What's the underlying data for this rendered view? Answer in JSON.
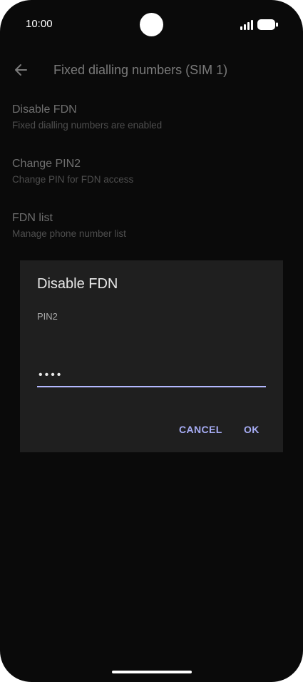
{
  "status_bar": {
    "time": "10:00",
    "icons": [
      "signal-icon",
      "battery-icon"
    ]
  },
  "app_bar": {
    "back_icon": "arrow-back-icon",
    "title": "Fixed dialling numbers (SIM 1)"
  },
  "settings": [
    {
      "title": "Disable FDN",
      "subtitle": "Fixed dialling numbers are enabled"
    },
    {
      "title": "Change PIN2",
      "subtitle": "Change PIN for FDN access"
    },
    {
      "title": "FDN list",
      "subtitle": "Manage phone number list"
    }
  ],
  "dialog": {
    "title": "Disable FDN",
    "label": "PIN2",
    "masked_value": "••••",
    "cancel_label": "CANCEL",
    "ok_label": "OK"
  },
  "colors": {
    "background": "#0a0a0a",
    "dialog_bg": "#1f1f1f",
    "accent": "#a7adf5",
    "input_underline": "#b3b8ff"
  }
}
